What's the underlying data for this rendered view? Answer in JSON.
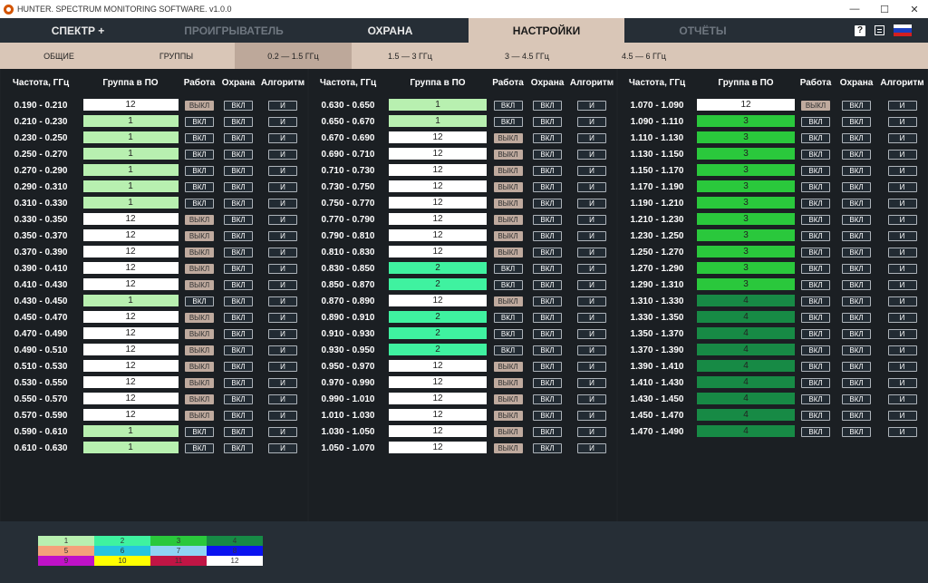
{
  "window": {
    "title": "HUNTER. SPECTRUM MONITORING SOFTWARE. v1.0.0",
    "controls": [
      "—",
      "☐",
      "✕"
    ]
  },
  "main_tabs": [
    {
      "label": "СПЕКТР +",
      "state": "normal"
    },
    {
      "label": "ПРОИГРЫВАТЕЛЬ",
      "state": "dim"
    },
    {
      "label": "ОХРАНА",
      "state": "normal"
    },
    {
      "label": "НАСТРОЙКИ",
      "state": "active"
    },
    {
      "label": "ОТЧЁТЫ",
      "state": "dim"
    }
  ],
  "header_icons": {
    "help": "?",
    "doc": "document-icon",
    "flag": "russia-flag-icon"
  },
  "sub_tabs": [
    {
      "label": "ОБЩИЕ",
      "active": false
    },
    {
      "label": "ГРУППЫ",
      "active": false
    },
    {
      "label": "0.2 — 1.5 ГГц",
      "active": true
    },
    {
      "label": "1.5 — 3 ГГц",
      "active": false
    },
    {
      "label": "3 — 4.5 ГГц",
      "active": false
    },
    {
      "label": "4.5 — 6 ГГц",
      "active": false
    }
  ],
  "columns": {
    "freq": "Частота, ГГц",
    "group": "Группа в ПО",
    "work": "Работа",
    "guard": "Охрана",
    "algo": "Алгоритм"
  },
  "states": {
    "on": "ВКЛ",
    "off": "ВЫКЛ",
    "and": "И"
  },
  "group_colors": {
    "1": "#b8f0b0",
    "2": "#3ff2a0",
    "3": "#2ac83c",
    "4": "#178a45",
    "12": "#ffffff"
  },
  "panels": [
    {
      "rows": [
        [
          "0.190 - 0.210",
          "12",
          "off",
          "on",
          "and"
        ],
        [
          "0.210 - 0.230",
          "1",
          "on",
          "on",
          "and"
        ],
        [
          "0.230 - 0.250",
          "1",
          "on",
          "on",
          "and"
        ],
        [
          "0.250 - 0.270",
          "1",
          "on",
          "on",
          "and"
        ],
        [
          "0.270 - 0.290",
          "1",
          "on",
          "on",
          "and"
        ],
        [
          "0.290 - 0.310",
          "1",
          "on",
          "on",
          "and"
        ],
        [
          "0.310 - 0.330",
          "1",
          "on",
          "on",
          "and"
        ],
        [
          "0.330 - 0.350",
          "12",
          "off",
          "on",
          "and"
        ],
        [
          "0.350 - 0.370",
          "12",
          "off",
          "on",
          "and"
        ],
        [
          "0.370 - 0.390",
          "12",
          "off",
          "on",
          "and"
        ],
        [
          "0.390 - 0.410",
          "12",
          "off",
          "on",
          "and"
        ],
        [
          "0.410 - 0.430",
          "12",
          "off",
          "on",
          "and"
        ],
        [
          "0.430 - 0.450",
          "1",
          "on",
          "on",
          "and"
        ],
        [
          "0.450 - 0.470",
          "12",
          "off",
          "on",
          "and"
        ],
        [
          "0.470 - 0.490",
          "12",
          "off",
          "on",
          "and"
        ],
        [
          "0.490 - 0.510",
          "12",
          "off",
          "on",
          "and"
        ],
        [
          "0.510 - 0.530",
          "12",
          "off",
          "on",
          "and"
        ],
        [
          "0.530 - 0.550",
          "12",
          "off",
          "on",
          "and"
        ],
        [
          "0.550 - 0.570",
          "12",
          "off",
          "on",
          "and"
        ],
        [
          "0.570 - 0.590",
          "12",
          "off",
          "on",
          "and"
        ],
        [
          "0.590 - 0.610",
          "1",
          "on",
          "on",
          "and"
        ],
        [
          "0.610 - 0.630",
          "1",
          "on",
          "on",
          "and"
        ]
      ]
    },
    {
      "rows": [
        [
          "0.630 - 0.650",
          "1",
          "on",
          "on",
          "and"
        ],
        [
          "0.650 - 0.670",
          "1",
          "on",
          "on",
          "and"
        ],
        [
          "0.670 - 0.690",
          "12",
          "off",
          "on",
          "and"
        ],
        [
          "0.690 - 0.710",
          "12",
          "off",
          "on",
          "and"
        ],
        [
          "0.710 - 0.730",
          "12",
          "off",
          "on",
          "and"
        ],
        [
          "0.730 - 0.750",
          "12",
          "off",
          "on",
          "and"
        ],
        [
          "0.750 - 0.770",
          "12",
          "off",
          "on",
          "and"
        ],
        [
          "0.770 - 0.790",
          "12",
          "off",
          "on",
          "and"
        ],
        [
          "0.790 - 0.810",
          "12",
          "off",
          "on",
          "and"
        ],
        [
          "0.810 - 0.830",
          "12",
          "off",
          "on",
          "and"
        ],
        [
          "0.830 - 0.850",
          "2",
          "on",
          "on",
          "and"
        ],
        [
          "0.850 - 0.870",
          "2",
          "on",
          "on",
          "and"
        ],
        [
          "0.870 - 0.890",
          "12",
          "off",
          "on",
          "and"
        ],
        [
          "0.890 - 0.910",
          "2",
          "on",
          "on",
          "and"
        ],
        [
          "0.910 - 0.930",
          "2",
          "on",
          "on",
          "and"
        ],
        [
          "0.930 - 0.950",
          "2",
          "on",
          "on",
          "and"
        ],
        [
          "0.950 - 0.970",
          "12",
          "off",
          "on",
          "and"
        ],
        [
          "0.970 - 0.990",
          "12",
          "off",
          "on",
          "and"
        ],
        [
          "0.990 - 1.010",
          "12",
          "off",
          "on",
          "and"
        ],
        [
          "1.010 - 1.030",
          "12",
          "off",
          "on",
          "and"
        ],
        [
          "1.030 - 1.050",
          "12",
          "off",
          "on",
          "and"
        ],
        [
          "1.050 - 1.070",
          "12",
          "off",
          "on",
          "and"
        ]
      ]
    },
    {
      "rows": [
        [
          "1.070 - 1.090",
          "12",
          "off",
          "on",
          "and"
        ],
        [
          "1.090 - 1.110",
          "3",
          "on",
          "on",
          "and"
        ],
        [
          "1.110 - 1.130",
          "3",
          "on",
          "on",
          "and"
        ],
        [
          "1.130 - 1.150",
          "3",
          "on",
          "on",
          "and"
        ],
        [
          "1.150 - 1.170",
          "3",
          "on",
          "on",
          "and"
        ],
        [
          "1.170 - 1.190",
          "3",
          "on",
          "on",
          "and"
        ],
        [
          "1.190 - 1.210",
          "3",
          "on",
          "on",
          "and"
        ],
        [
          "1.210 - 1.230",
          "3",
          "on",
          "on",
          "and"
        ],
        [
          "1.230 - 1.250",
          "3",
          "on",
          "on",
          "and"
        ],
        [
          "1.250 - 1.270",
          "3",
          "on",
          "on",
          "and"
        ],
        [
          "1.270 - 1.290",
          "3",
          "on",
          "on",
          "and"
        ],
        [
          "1.290 - 1.310",
          "3",
          "on",
          "on",
          "and"
        ],
        [
          "1.310 - 1.330",
          "4",
          "on",
          "on",
          "and"
        ],
        [
          "1.330 - 1.350",
          "4",
          "on",
          "on",
          "and"
        ],
        [
          "1.350 - 1.370",
          "4",
          "on",
          "on",
          "and"
        ],
        [
          "1.370 - 1.390",
          "4",
          "on",
          "on",
          "and"
        ],
        [
          "1.390 - 1.410",
          "4",
          "on",
          "on",
          "and"
        ],
        [
          "1.410 - 1.430",
          "4",
          "on",
          "on",
          "and"
        ],
        [
          "1.430 - 1.450",
          "4",
          "on",
          "on",
          "and"
        ],
        [
          "1.450 - 1.470",
          "4",
          "on",
          "on",
          "and"
        ],
        [
          "1.470 - 1.490",
          "4",
          "on",
          "on",
          "and"
        ]
      ]
    }
  ],
  "legend": [
    {
      "label": "1",
      "color": "#b8f0b0"
    },
    {
      "label": "2",
      "color": "#3ff2a0"
    },
    {
      "label": "3",
      "color": "#2ac83c"
    },
    {
      "label": "4",
      "color": "#178a45"
    },
    {
      "label": "5",
      "color": "#f4a27a"
    },
    {
      "label": "6",
      "color": "#26c5df"
    },
    {
      "label": "7",
      "color": "#8fd3f4"
    },
    {
      "label": "8",
      "color": "#0a12f0"
    },
    {
      "label": "9",
      "color": "#c012c8"
    },
    {
      "label": "10",
      "color": "#ffff00"
    },
    {
      "label": "11",
      "color": "#c01545"
    },
    {
      "label": "12",
      "color": "#ffffff"
    }
  ]
}
